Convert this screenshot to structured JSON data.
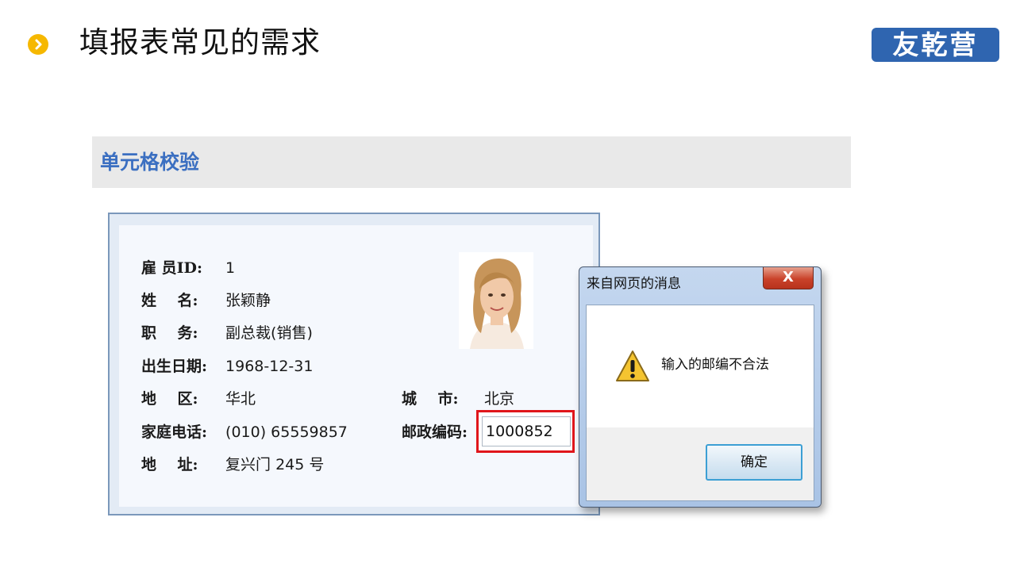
{
  "header": {
    "title": "填报表常见的需求",
    "logo_text": "友乾营",
    "bullet_color": "#f6b800",
    "logo_color": "#2f65b0"
  },
  "section": {
    "title": "单元格校验",
    "title_color": "#3b6fc1"
  },
  "employee_form": {
    "fields": {
      "employee_id": {
        "label": "雇 员ID:",
        "value": "1"
      },
      "name": {
        "label": "姓    名:",
        "value": "张颖静"
      },
      "position": {
        "label": "职    务:",
        "value": "副总裁(销售)"
      },
      "birth_date": {
        "label": "出生日期:",
        "value": "1968-12-31"
      },
      "region": {
        "label": "地    区:",
        "value": "华北"
      },
      "home_phone": {
        "label": "家庭电话:",
        "value": "(010) 65559857"
      },
      "address": {
        "label": "地    址:",
        "value": "复兴门 245 号"
      },
      "city": {
        "label": "城    市:",
        "value": "北京"
      },
      "postal_code": {
        "label": "邮政编码:",
        "value": "1000852"
      }
    },
    "highlight_color": "#e0161b"
  },
  "dialog": {
    "title": "来自网页的消息",
    "close_glyph": "X",
    "message": "输入的邮编不合法",
    "ok_label": "确定",
    "icon": "warning-icon"
  }
}
